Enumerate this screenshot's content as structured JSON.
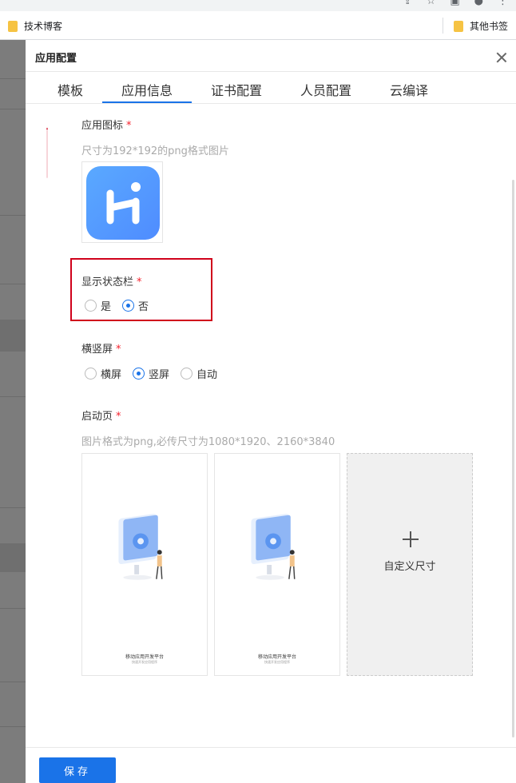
{
  "bookmarks": {
    "left_label": "技术博客",
    "right_label": "其他书签"
  },
  "drawer": {
    "title": "应用配置",
    "tabs": [
      {
        "label": "模板"
      },
      {
        "label": "应用信息",
        "active": true
      },
      {
        "label": "证书配置"
      },
      {
        "label": "人员配置"
      },
      {
        "label": "云编译"
      }
    ]
  },
  "app_icon": {
    "label": "应用图标",
    "required_mark": "*",
    "hint": "尺寸为192*192的png格式图片"
  },
  "status_bar": {
    "label": "显示状态栏",
    "required_mark": "*",
    "options": [
      {
        "label": "是",
        "checked": false
      },
      {
        "label": "否",
        "checked": true
      }
    ]
  },
  "orientation": {
    "label": "横竖屏",
    "required_mark": "*",
    "options": [
      {
        "label": "横屏",
        "checked": false
      },
      {
        "label": "竖屏",
        "checked": true
      },
      {
        "label": "自动",
        "checked": false
      }
    ]
  },
  "splash": {
    "label": "启动页",
    "required_mark": "*",
    "hint": "图片格式为png,必传尺寸为1080*1920、2160*3840",
    "cards": [
      {
        "caption": "移动应用开发平台",
        "sub": "快速开发应用程序"
      },
      {
        "caption": "移动应用开发平台",
        "sub": "快速开发应用程序"
      }
    ],
    "custom_label": "自定义尺寸"
  },
  "footer": {
    "save_label": "保存"
  },
  "colors": {
    "accent": "#1a73e8",
    "highlight": "#d0021b",
    "required": "#f5222d"
  }
}
